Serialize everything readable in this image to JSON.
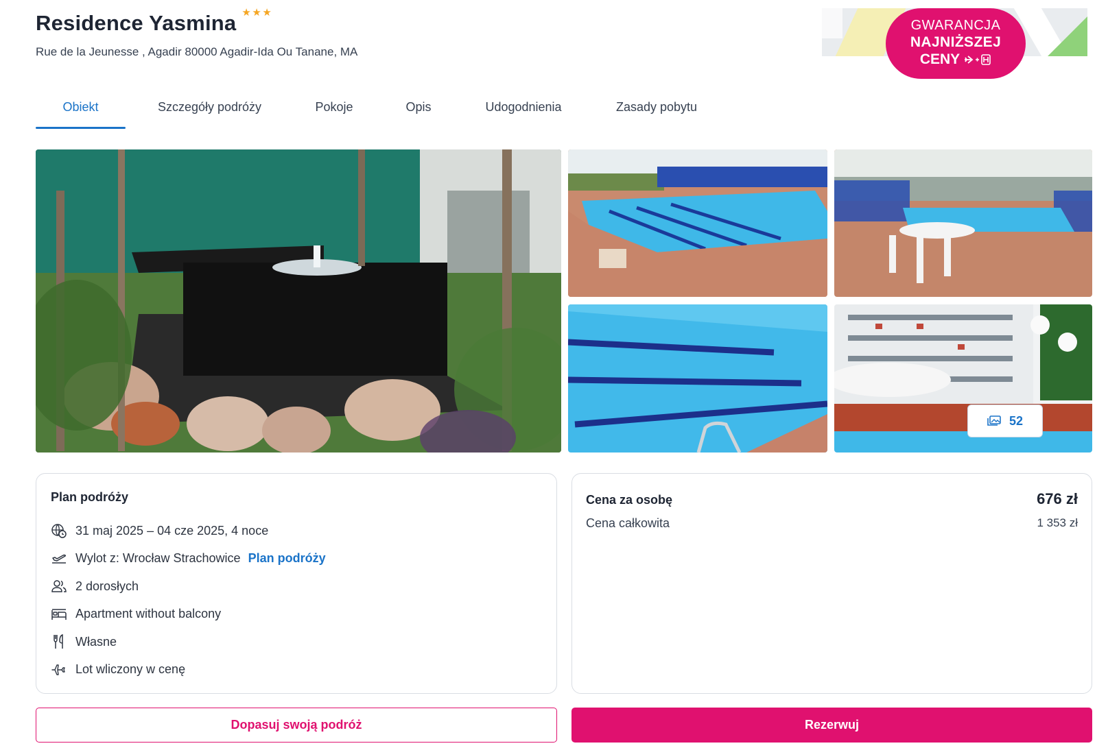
{
  "hotel": {
    "name": "Residence Yasmina",
    "stars": 3,
    "address": "Rue de la Jeunesse , Agadir 80000 Agadir-Ida Ou Tanane, MA"
  },
  "badge": {
    "line1": "GWARANCJA",
    "line2": "NAJNIŻSZEJ",
    "line3": "CENY"
  },
  "tabs": [
    {
      "label": "Obiekt",
      "active": true
    },
    {
      "label": "Szczegóły podróży",
      "active": false
    },
    {
      "label": "Pokoje",
      "active": false
    },
    {
      "label": "Opis",
      "active": false
    },
    {
      "label": "Udogodnienia",
      "active": false
    },
    {
      "label": "Zasady pobytu",
      "active": false
    }
  ],
  "gallery": {
    "photo_count": "52"
  },
  "plan": {
    "title": "Plan podróży",
    "dates": "31 maj 2025 – 04 cze 2025, 4 noce",
    "departure": "Wylot z: Wrocław Strachowice",
    "departure_link": "Plan podróży",
    "guests": "2 dorosłych",
    "room": "Apartment without balcony",
    "board": "Własne",
    "flight": "Lot wliczony w cenę",
    "icons": [
      "calendar-globe-icon",
      "plane-departure-icon",
      "users-icon",
      "bed-icon",
      "fork-knife-icon",
      "plane-icon"
    ]
  },
  "price": {
    "per_person_label": "Cena za osobę",
    "per_person_value": "676 zł",
    "total_label": "Cena całkowita",
    "total_value": "1 353 zł"
  },
  "buttons": {
    "customize": "Dopasuj swoją podróż",
    "book": "Rezerwuj"
  },
  "colors": {
    "brand_pink": "#e0116f",
    "link_blue": "#1a73c8",
    "star": "#f5a623"
  }
}
